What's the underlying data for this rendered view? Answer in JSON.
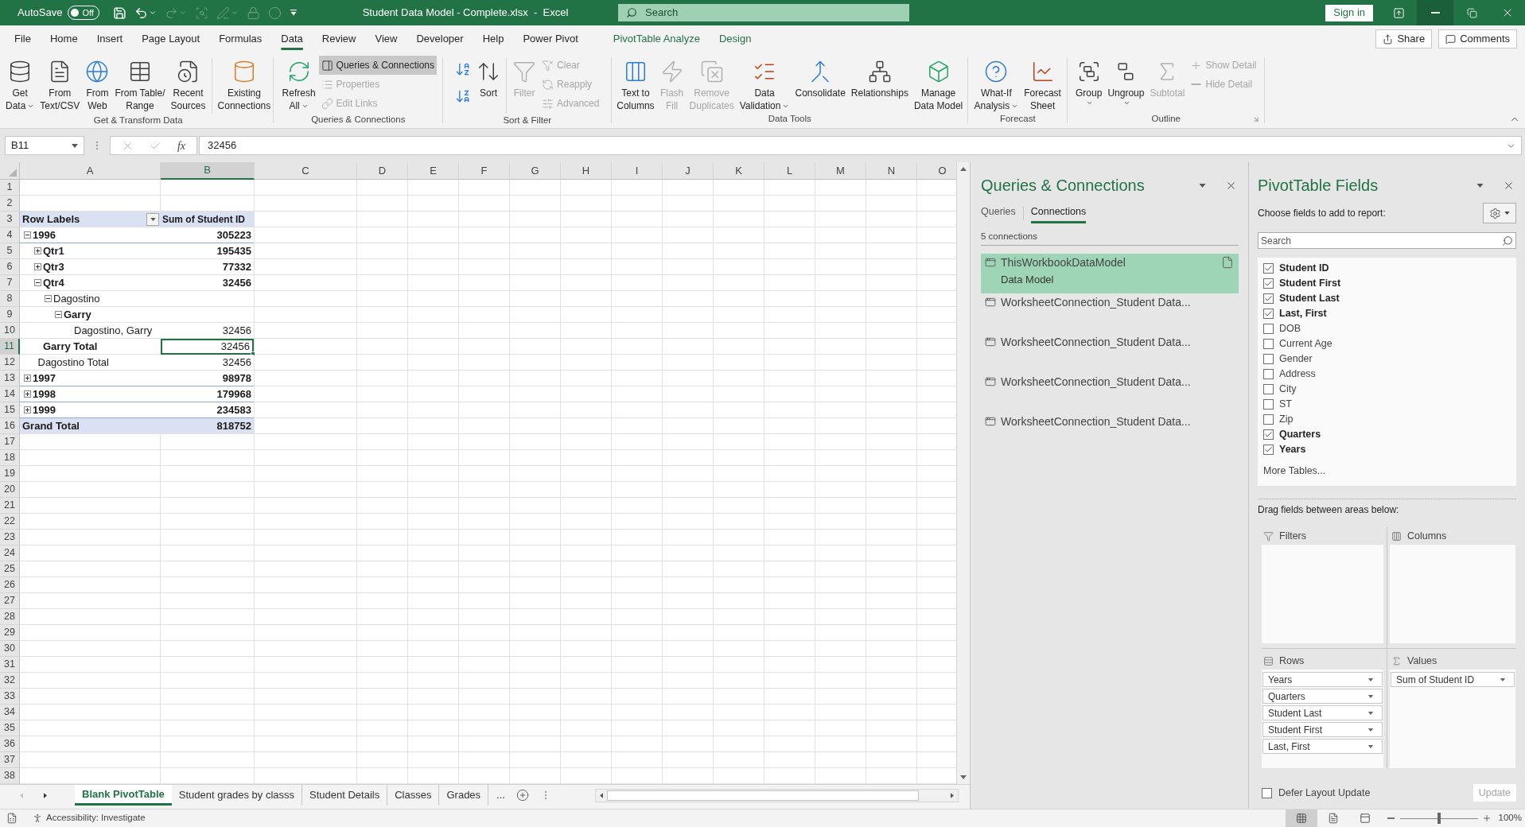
{
  "title_bar": {
    "autosave_label": "AutoSave",
    "autosave": {
      "label": "Off",
      "on": false
    },
    "quick_access": [
      {
        "disabled": false
      },
      {
        "disabled": false
      },
      {
        "disabled": true
      },
      {
        "disabled": true
      },
      {
        "disabled": true
      },
      {
        "disabled": true
      },
      {
        "disabled": true
      },
      {
        "disabled": false
      }
    ],
    "document_title": "Student Data Model - Complete.xlsx  -  Excel",
    "search_placeholder": "Search",
    "sign_in": "Sign in"
  },
  "ribbon_tabs": [
    {
      "label": "File",
      "selected": false,
      "contextual": false
    },
    {
      "label": "Home",
      "selected": false,
      "contextual": false
    },
    {
      "label": "Insert",
      "selected": false,
      "contextual": false
    },
    {
      "label": "Page Layout",
      "selected": false,
      "contextual": false
    },
    {
      "label": "Formulas",
      "selected": false,
      "contextual": false
    },
    {
      "label": "Data",
      "selected": true,
      "contextual": false
    },
    {
      "label": "Review",
      "selected": false,
      "contextual": false
    },
    {
      "label": "View",
      "selected": false,
      "contextual": false
    },
    {
      "label": "Developer",
      "selected": false,
      "contextual": false
    },
    {
      "label": "Help",
      "selected": false,
      "contextual": false
    },
    {
      "label": "Power Pivot",
      "selected": false,
      "contextual": false
    },
    {
      "label": "PivotTable Analyze",
      "selected": false,
      "contextual": true
    },
    {
      "label": "Design",
      "selected": false,
      "contextual": true
    }
  ],
  "share_button": "Share",
  "comments_button": "Comments",
  "ribbon_groups": [
    {
      "label": "Get & Transform Data",
      "dialog_launcher": false,
      "commands": [
        {
          "kind": "large",
          "lines": [
            "Get",
            "Data"
          ],
          "dropdown": true,
          "disabled": false
        },
        {
          "kind": "large",
          "lines": [
            "From",
            "Text/CSV"
          ],
          "dropdown": false,
          "disabled": false
        },
        {
          "kind": "large",
          "lines": [
            "From",
            "Web"
          ],
          "dropdown": false,
          "disabled": false
        },
        {
          "kind": "large",
          "lines": [
            "From Table/",
            "Range"
          ],
          "dropdown": false,
          "disabled": false
        },
        {
          "kind": "large",
          "lines": [
            "Recent",
            "Sources"
          ],
          "dropdown": false,
          "disabled": false
        },
        {
          "kind": "separator"
        },
        {
          "kind": "large",
          "lines": [
            "Existing",
            "Connections"
          ],
          "dropdown": false,
          "disabled": false
        }
      ]
    },
    {
      "label": "Queries & Connections",
      "dialog_launcher": false,
      "commands": [
        {
          "kind": "large",
          "lines": [
            "Refresh",
            "All"
          ],
          "dropdown": true,
          "disabled": false
        },
        {
          "kind": "stack",
          "items": [
            {
              "label": "Queries & Connections",
              "pressed": true,
              "disabled": false
            },
            {
              "label": "Properties",
              "pressed": false,
              "disabled": true
            },
            {
              "label": "Edit Links",
              "pressed": false,
              "disabled": true
            }
          ]
        }
      ]
    },
    {
      "label": "Sort & Filter",
      "dialog_launcher": false,
      "commands": [
        {
          "kind": "icon_stack",
          "items": [
            {
              "disabled": false
            },
            {
              "disabled": false
            }
          ]
        },
        {
          "kind": "large",
          "lines": [
            "Sort"
          ],
          "dropdown": false,
          "disabled": false
        },
        {
          "kind": "separator"
        },
        {
          "kind": "large",
          "lines": [
            "Filter"
          ],
          "dropdown": false,
          "disabled": true
        },
        {
          "kind": "stack",
          "items": [
            {
              "label": "Clear",
              "pressed": false,
              "disabled": true
            },
            {
              "label": "Reapply",
              "pressed": false,
              "disabled": true
            },
            {
              "label": "Advanced",
              "pressed": false,
              "disabled": true
            }
          ]
        }
      ]
    },
    {
      "label": "Data Tools",
      "dialog_launcher": false,
      "commands": [
        {
          "kind": "large",
          "lines": [
            "Text to",
            "Columns"
          ],
          "dropdown": false,
          "disabled": false
        },
        {
          "kind": "large",
          "lines": [
            "Flash",
            "Fill"
          ],
          "dropdown": false,
          "disabled": true
        },
        {
          "kind": "large",
          "lines": [
            "Remove",
            "Duplicates"
          ],
          "dropdown": false,
          "disabled": true
        },
        {
          "kind": "large",
          "lines": [
            "Data",
            "Validation"
          ],
          "dropdown": true,
          "disabled": false
        },
        {
          "kind": "large",
          "lines": [
            "Consolidate"
          ],
          "dropdown": false,
          "disabled": false
        },
        {
          "kind": "large",
          "lines": [
            "Relationships"
          ],
          "dropdown": false,
          "disabled": false
        },
        {
          "kind": "large",
          "lines": [
            "Manage",
            "Data Model"
          ],
          "dropdown": false,
          "disabled": false
        }
      ]
    },
    {
      "label": "Forecast",
      "dialog_launcher": false,
      "commands": [
        {
          "kind": "large",
          "lines": [
            "What-If",
            "Analysis"
          ],
          "dropdown": true,
          "disabled": false
        },
        {
          "kind": "large",
          "lines": [
            "Forecast",
            "Sheet"
          ],
          "dropdown": false,
          "disabled": false
        }
      ]
    },
    {
      "label": "Outline",
      "dialog_launcher": true,
      "commands": [
        {
          "kind": "large",
          "lines": [
            "Group"
          ],
          "dropdown": true,
          "disabled": false
        },
        {
          "kind": "large",
          "lines": [
            "Ungroup"
          ],
          "dropdown": true,
          "disabled": false
        },
        {
          "kind": "large",
          "lines": [
            "Subtotal"
          ],
          "dropdown": false,
          "disabled": true
        },
        {
          "kind": "stack",
          "items": [
            {
              "label": "Show Detail",
              "pressed": false,
              "disabled": true
            },
            {
              "label": "Hide Detail",
              "pressed": false,
              "disabled": true
            }
          ]
        }
      ]
    }
  ],
  "formula_bar": {
    "name_box": "B11",
    "edit_controls": [
      {
        "disabled": true
      },
      {
        "disabled": true
      }
    ],
    "function_label": "fx",
    "formula": "32456"
  },
  "sheet": {
    "columns": [
      {
        "label": "A",
        "selected": false
      },
      {
        "label": "B",
        "selected": true
      },
      {
        "label": "C",
        "selected": false
      },
      {
        "label": "D",
        "selected": false
      },
      {
        "label": "E",
        "selected": false
      },
      {
        "label": "F",
        "selected": false
      },
      {
        "label": "G",
        "selected": false
      },
      {
        "label": "H",
        "selected": false
      },
      {
        "label": "I",
        "selected": false
      },
      {
        "label": "J",
        "selected": false
      },
      {
        "label": "K",
        "selected": false
      },
      {
        "label": "L",
        "selected": false
      },
      {
        "label": "M",
        "selected": false
      },
      {
        "label": "N",
        "selected": false
      },
      {
        "label": "O",
        "selected": false
      }
    ],
    "rows": [
      {
        "label": "1",
        "selected": false
      },
      {
        "label": "2",
        "selected": false
      },
      {
        "label": "3",
        "selected": false
      },
      {
        "label": "4",
        "selected": false
      },
      {
        "label": "5",
        "selected": false
      },
      {
        "label": "6",
        "selected": false
      },
      {
        "label": "7",
        "selected": false
      },
      {
        "label": "8",
        "selected": false
      },
      {
        "label": "9",
        "selected": false
      },
      {
        "label": "10",
        "selected": false
      },
      {
        "label": "11",
        "selected": true
      },
      {
        "label": "12",
        "selected": false
      },
      {
        "label": "13",
        "selected": false
      },
      {
        "label": "14",
        "selected": false
      },
      {
        "label": "15",
        "selected": false
      },
      {
        "label": "16",
        "selected": false
      },
      {
        "label": "17",
        "selected": false
      },
      {
        "label": "18",
        "selected": false
      },
      {
        "label": "19",
        "selected": false
      },
      {
        "label": "20",
        "selected": false
      },
      {
        "label": "21",
        "selected": false
      },
      {
        "label": "22",
        "selected": false
      },
      {
        "label": "23",
        "selected": false
      },
      {
        "label": "24",
        "selected": false
      },
      {
        "label": "25",
        "selected": false
      },
      {
        "label": "26",
        "selected": false
      },
      {
        "label": "27",
        "selected": false
      },
      {
        "label": "28",
        "selected": false
      },
      {
        "label": "29",
        "selected": false
      },
      {
        "label": "30",
        "selected": false
      },
      {
        "label": "31",
        "selected": false
      },
      {
        "label": "32",
        "selected": false
      },
      {
        "label": "33",
        "selected": false
      },
      {
        "label": "34",
        "selected": false
      },
      {
        "label": "35",
        "selected": false
      },
      {
        "label": "36",
        "selected": false
      },
      {
        "label": "37",
        "selected": false
      },
      {
        "label": "38",
        "selected": false
      }
    ],
    "pivot_table": {
      "header": {
        "label": "Row Labels",
        "value": "Sum of Student ID",
        "selected": false
      },
      "rows": [
        {
          "label": "1996",
          "value": "305223",
          "expanded": true,
          "label_bold": true,
          "value_bold": true,
          "selected": false,
          "children": [
            {
              "label": "Qtr1",
              "value": "195435",
              "expanded": false,
              "label_bold": true,
              "value_bold": true,
              "selected": false
            },
            {
              "label": "Qtr3",
              "value": "77332",
              "expanded": false,
              "label_bold": true,
              "value_bold": true,
              "selected": false
            },
            {
              "label": "Qtr4",
              "value": "32456",
              "expanded": true,
              "label_bold": true,
              "value_bold": true,
              "selected": false,
              "children": [
                {
                  "label": "Dagostino",
                  "expanded": true,
                  "label_bold": false,
                  "selected": false,
                  "children": [
                    {
                      "label": "Garry",
                      "expanded": true,
                      "label_bold": true,
                      "selected": false,
                      "children": [
                        {
                          "label": "Dagostino, Garry",
                          "value": "32456",
                          "label_bold": false,
                          "value_bold": false,
                          "selected": false
                        }
                      ],
                      "total": {
                        "label": "Garry Total",
                        "value": "32456",
                        "label_bold": true,
                        "value_bold": false,
                        "selected": true
                      }
                    }
                  ],
                  "total": {
                    "label": "Dagostino Total",
                    "value": "32456",
                    "label_bold": false,
                    "value_bold": false,
                    "selected": false
                  }
                }
              ]
            }
          ]
        },
        {
          "label": "1997",
          "value": "98978",
          "expanded": false,
          "label_bold": true,
          "value_bold": true,
          "selected": false
        },
        {
          "label": "1998",
          "value": "179968",
          "expanded": false,
          "label_bold": true,
          "value_bold": true,
          "selected": false
        },
        {
          "label": "1999",
          "value": "234583",
          "expanded": false,
          "label_bold": true,
          "value_bold": true,
          "selected": false
        }
      ],
      "grand_total": {
        "label": "Grand Total",
        "value": "818752",
        "selected": false
      }
    }
  },
  "sheet_nav": [
    {
      "disabled": true
    },
    {
      "disabled": false
    }
  ],
  "sheet_tabs": [
    {
      "label": "Blank PivotTable",
      "selected": true
    },
    {
      "label": "Student grades by classs",
      "selected": false
    },
    {
      "label": "Student Details",
      "selected": false
    },
    {
      "label": "Classes",
      "selected": false
    },
    {
      "label": "Grades",
      "selected": false
    }
  ],
  "more_sheets": "...",
  "queries_pane": {
    "title": "Queries & Connections",
    "tabs": [
      {
        "label": "Queries",
        "selected": false
      },
      {
        "label": "Connections",
        "selected": true
      }
    ],
    "count": "5 connections",
    "connections": [
      {
        "name": "ThisWorkbookDataModel",
        "description": "Data Model",
        "selected": true
      },
      {
        "name": "WorksheetConnection_Student Data...",
        "selected": false
      },
      {
        "name": "WorksheetConnection_Student Data...",
        "selected": false
      },
      {
        "name": "WorksheetConnection_Student Data...",
        "selected": false
      },
      {
        "name": "WorksheetConnection_Student Data...",
        "selected": false
      }
    ]
  },
  "fields_pane": {
    "title": "PivotTable Fields",
    "instruction": "Choose fields to add to report:",
    "search_placeholder": "Search",
    "fields": [
      {
        "name": "Student ID",
        "checked": true
      },
      {
        "name": "Student First",
        "checked": true
      },
      {
        "name": "Student Last",
        "checked": true
      },
      {
        "name": "Last, First",
        "checked": true
      },
      {
        "name": "DOB",
        "checked": false
      },
      {
        "name": "Current Age",
        "checked": false
      },
      {
        "name": "Gender",
        "checked": false
      },
      {
        "name": "Address",
        "checked": false
      },
      {
        "name": "City",
        "checked": false
      },
      {
        "name": "ST",
        "checked": false
      },
      {
        "name": "Zip",
        "checked": false
      },
      {
        "name": "Quarters",
        "checked": true
      },
      {
        "name": "Years",
        "checked": true
      }
    ],
    "more_tables": "More Tables...",
    "areas_instruction": "Drag fields between areas below:",
    "areas": [
      {
        "kind": "filters",
        "title": "Filters"
      },
      {
        "kind": "columns",
        "title": "Columns"
      },
      {
        "kind": "rows",
        "title": "Rows",
        "items": [
          "Years",
          "Quarters",
          "Student Last",
          "Student First",
          "Last, First"
        ]
      },
      {
        "kind": "values",
        "title": "Values",
        "items": [
          "Sum of Student ID"
        ]
      }
    ],
    "defer": {
      "label": "Defer Layout Update",
      "checked": false
    },
    "update_button": {
      "label": "Update",
      "disabled": true
    }
  },
  "status_bar": {
    "accessibility": "Accessibility: Investigate",
    "views": [
      {
        "kind": "normal",
        "selected": true
      },
      {
        "kind": "page_layout",
        "selected": false
      },
      {
        "kind": "page_break",
        "selected": false
      }
    ],
    "zoom_slider": {
      "level": 0.5
    },
    "zoom": "100%"
  }
}
